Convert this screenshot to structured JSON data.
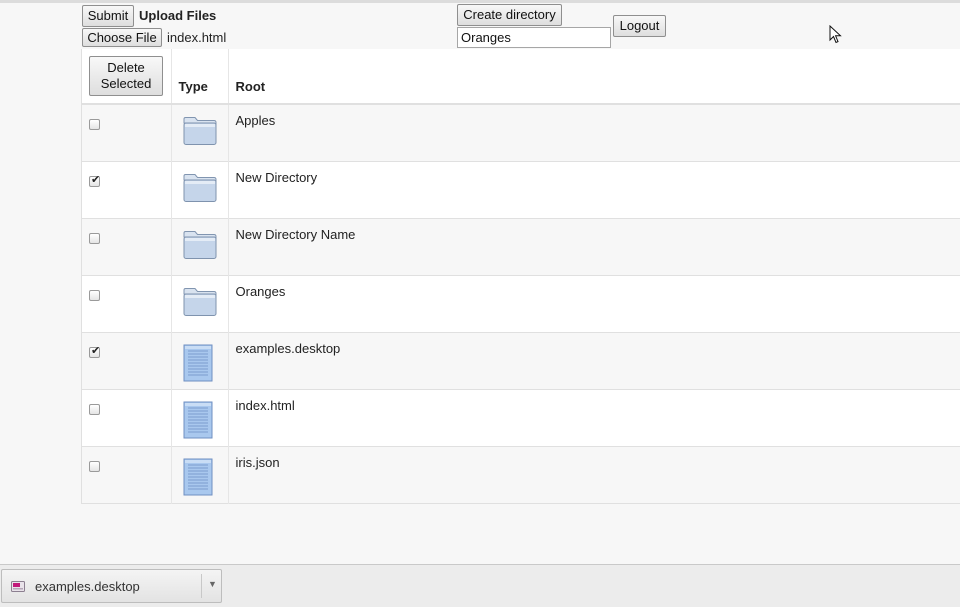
{
  "toolbar": {
    "submit_label": "Submit",
    "upload_title": "Upload Files",
    "choose_file_label": "Choose File",
    "chosen_file_name": "index.html",
    "create_directory_label": "Create directory",
    "directory_name_value": "Oranges",
    "logout_label": "Logout"
  },
  "table": {
    "delete_selected_label": "Delete Selected",
    "headers": {
      "type": "Type",
      "root": "Root"
    },
    "rows": [
      {
        "name": "Apples",
        "kind": "folder-icon",
        "checked": false
      },
      {
        "name": "New Directory",
        "kind": "folder-icon",
        "checked": true
      },
      {
        "name": "New Directory Name",
        "kind": "folder-icon",
        "checked": false
      },
      {
        "name": "Oranges",
        "kind": "folder-icon",
        "checked": false
      },
      {
        "name": "examples.desktop",
        "kind": "document-icon",
        "checked": true
      },
      {
        "name": "index.html",
        "kind": "document-icon",
        "checked": false
      },
      {
        "name": "iris.json",
        "kind": "document-icon",
        "checked": false
      }
    ]
  },
  "downloads_bar": {
    "item_name": "examples.desktop"
  },
  "colors": {
    "folder_fill": "#c5d5ea",
    "document_fill": "#a9c8ee"
  }
}
